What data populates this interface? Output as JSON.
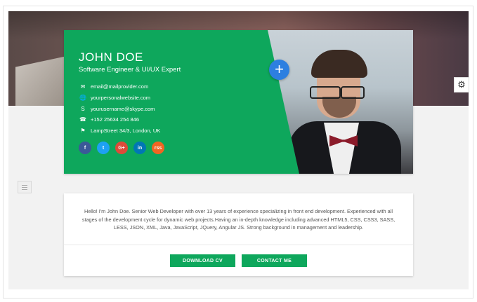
{
  "profile": {
    "name": "JOHN DOE",
    "role": "Software Engineer & UI/UX Expert",
    "contacts": [
      {
        "icon": "envelope-icon",
        "text": "email@mailprovider.com"
      },
      {
        "icon": "globe-icon",
        "text": "yourpersonalwebsite.com"
      },
      {
        "icon": "skype-icon",
        "text": "yourusername@skype.com"
      },
      {
        "icon": "phone-icon",
        "text": "+152 25634 254 846"
      },
      {
        "icon": "map-marker-icon",
        "text": "LampStreet 34/3, London, UK"
      }
    ],
    "social": [
      {
        "name": "facebook",
        "label": "f",
        "color": "#3b5998"
      },
      {
        "name": "twitter",
        "label": "t",
        "color": "#1da1f2"
      },
      {
        "name": "google-plus",
        "label": "G+",
        "color": "#dd4b39"
      },
      {
        "name": "linkedin",
        "label": "in",
        "color": "#0077b5"
      },
      {
        "name": "rss",
        "label": "rss",
        "color": "#f26522"
      }
    ]
  },
  "about": {
    "text": "Hello! I'm John Doe. Senior Web Developer with over 13 years of experience specializing in front end development. Experienced with all stages of the development cycle for dynamic web projects.Having an in-depth knowledge including advanced HTML5, CSS, CSS3, SASS, LESS, JSON, XML, Java, JavaScript, JQuery, Angular JS. Strong background in management and leadership."
  },
  "buttons": {
    "download": "DOWNLOAD CV",
    "contact": "CONTACT ME",
    "plus": "+"
  },
  "colors": {
    "accent": "#0ea75c",
    "plus": "#2d7fe0"
  }
}
